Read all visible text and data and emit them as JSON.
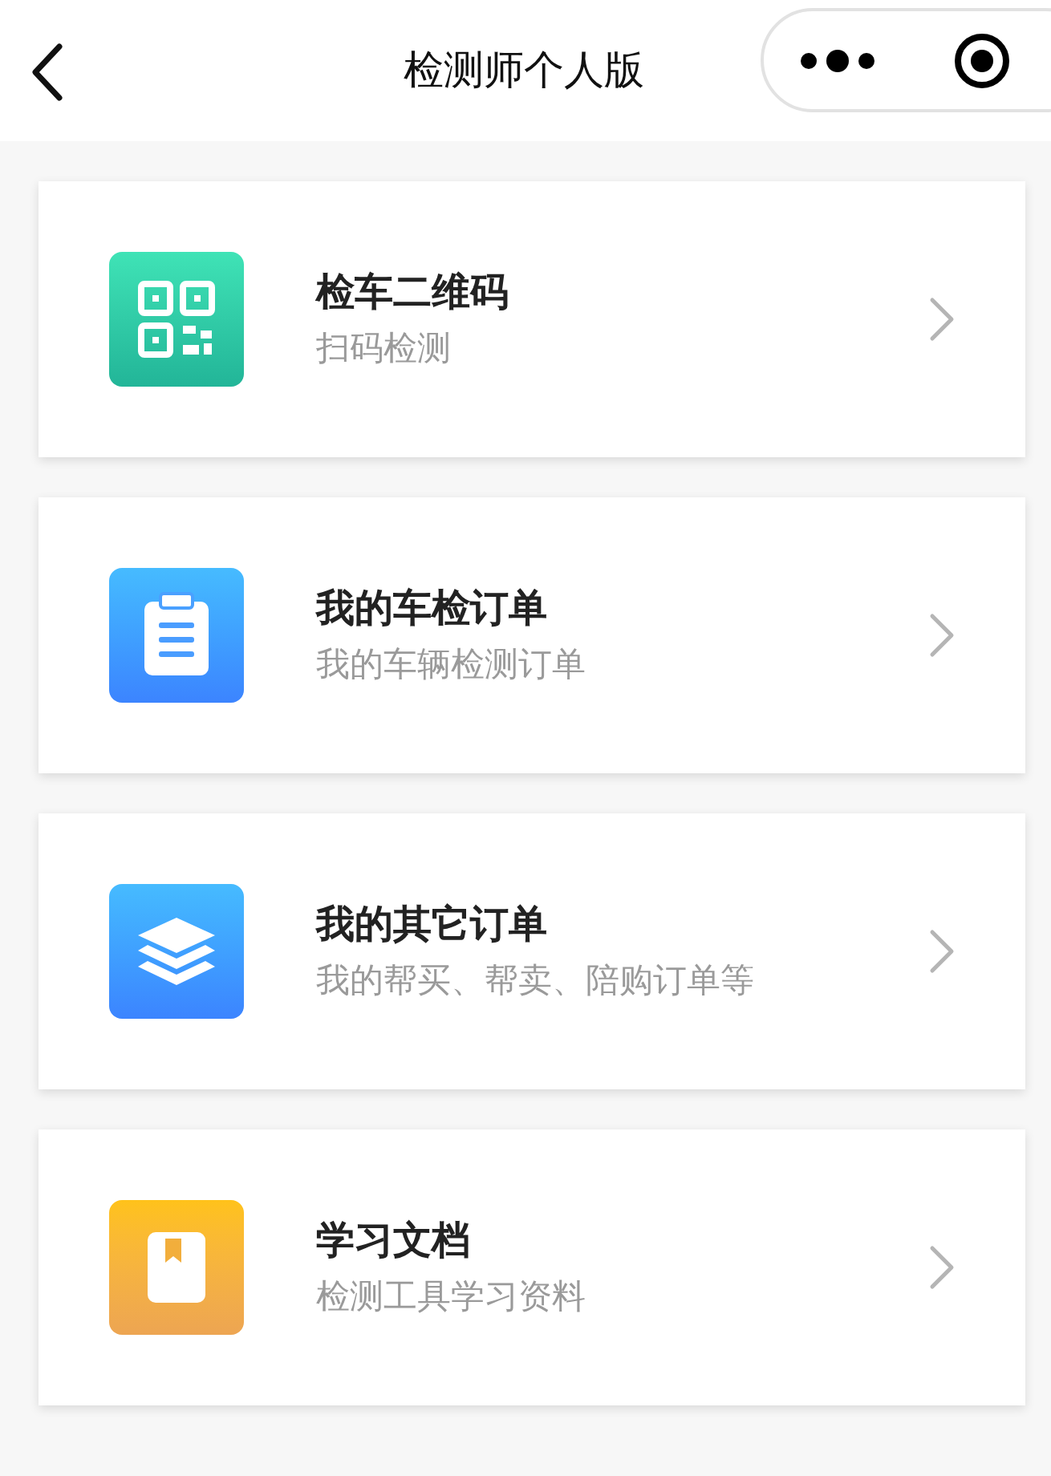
{
  "header": {
    "title": "检测师个人版"
  },
  "menu": [
    {
      "kind": "qrcode",
      "title": "检车二维码",
      "subtitle": "扫码检测"
    },
    {
      "kind": "clipboard",
      "title": "我的车检订单",
      "subtitle": "我的车辆检测订单"
    },
    {
      "kind": "layers",
      "title": "我的其它订单",
      "subtitle": "我的帮买、帮卖、陪购订单等"
    },
    {
      "kind": "book",
      "title": "学习文档",
      "subtitle": "检测工具学习资料"
    }
  ]
}
